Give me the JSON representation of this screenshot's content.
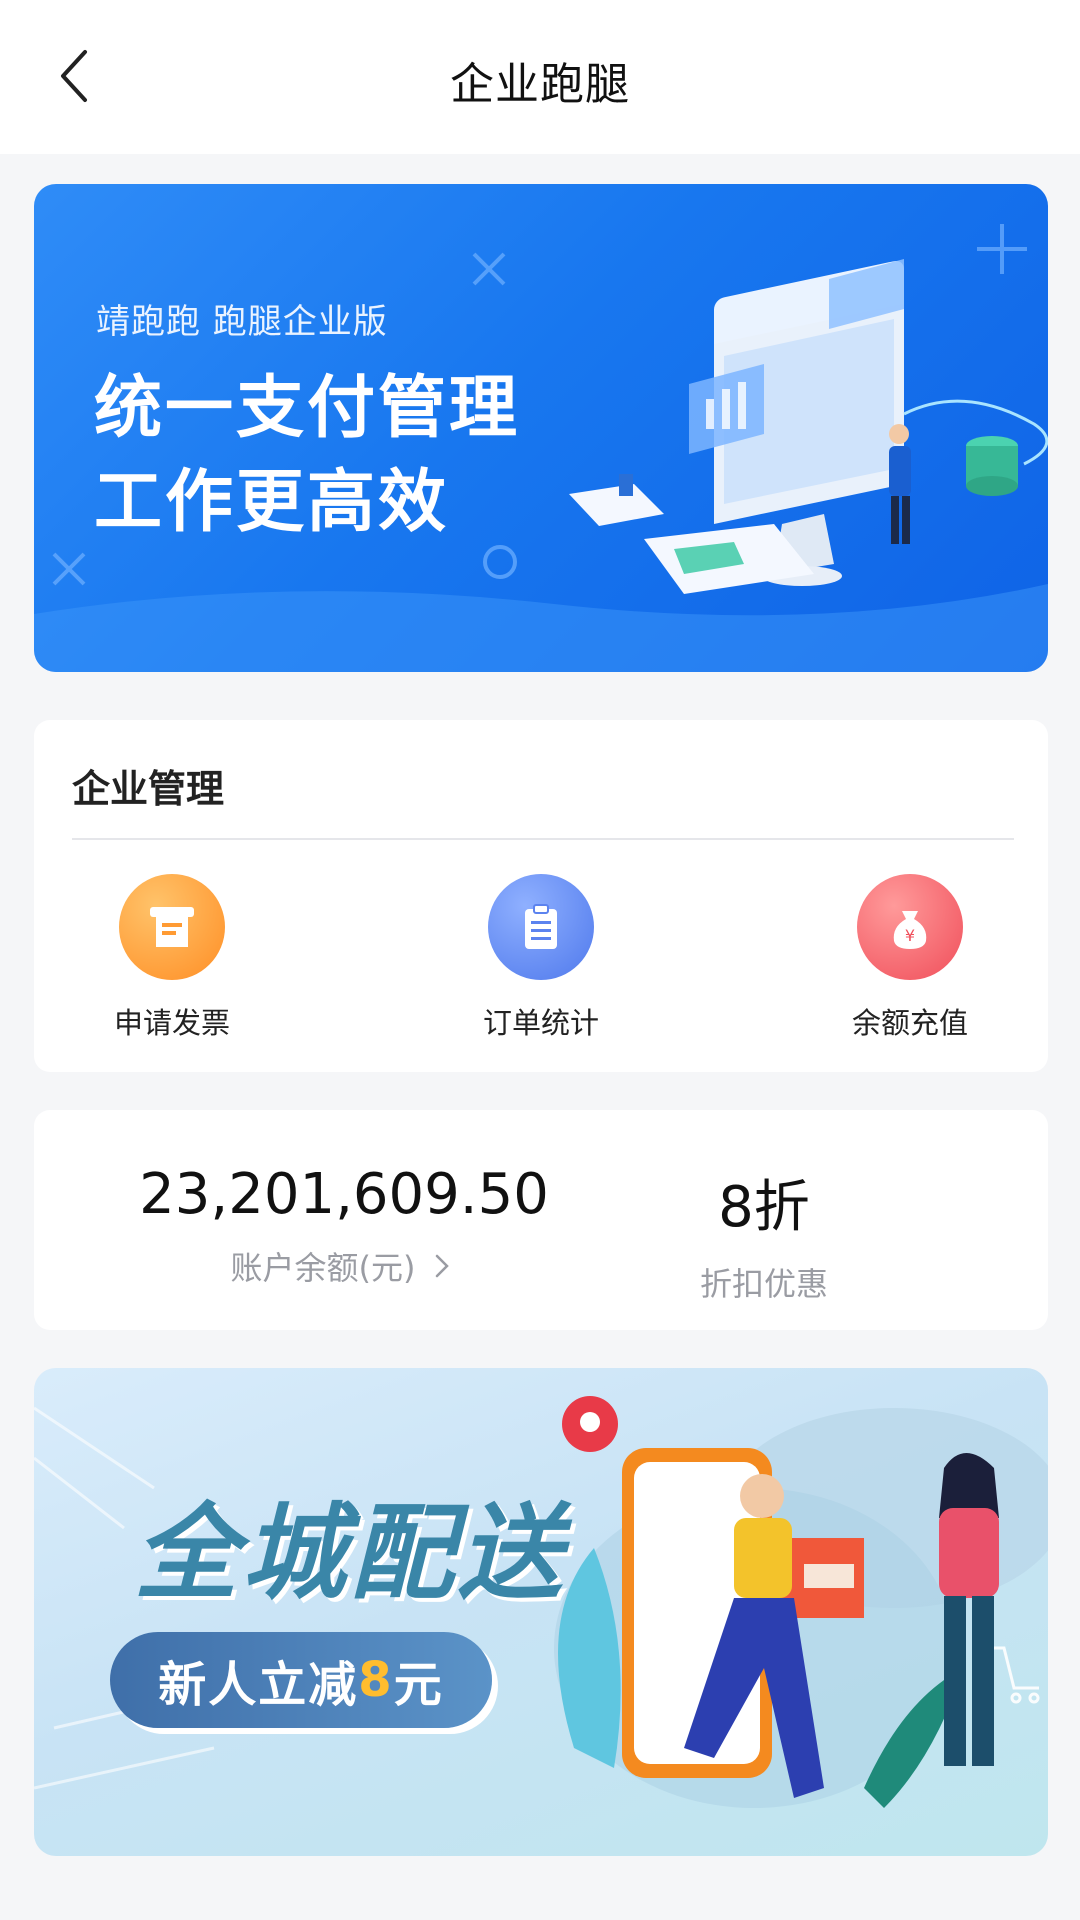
{
  "header": {
    "title": "企业跑腿",
    "back_icon": "chevron-left-icon"
  },
  "banner": {
    "subtitle": "靖跑跑 跑腿企业版",
    "headline_1": "统一支付管理",
    "headline_2": "工作更高效"
  },
  "management": {
    "title": "企业管理",
    "items": [
      {
        "label": "申请发票",
        "icon": "invoice-icon",
        "color": "#ff9b33"
      },
      {
        "label": "订单统计",
        "icon": "clipboard-icon",
        "color": "#5c83ef"
      },
      {
        "label": "余额充值",
        "icon": "money-bag-icon",
        "color": "#f4606a"
      }
    ]
  },
  "stats": {
    "balance_value": "23,201,609.50",
    "balance_label": "账户余额(元)",
    "discount_value": "8折",
    "discount_label": "折扣优惠"
  },
  "promo": {
    "headline": "全城配送",
    "pill_text_prefix": "新人立减",
    "pill_text_amount": "8",
    "pill_text_suffix": "元"
  }
}
